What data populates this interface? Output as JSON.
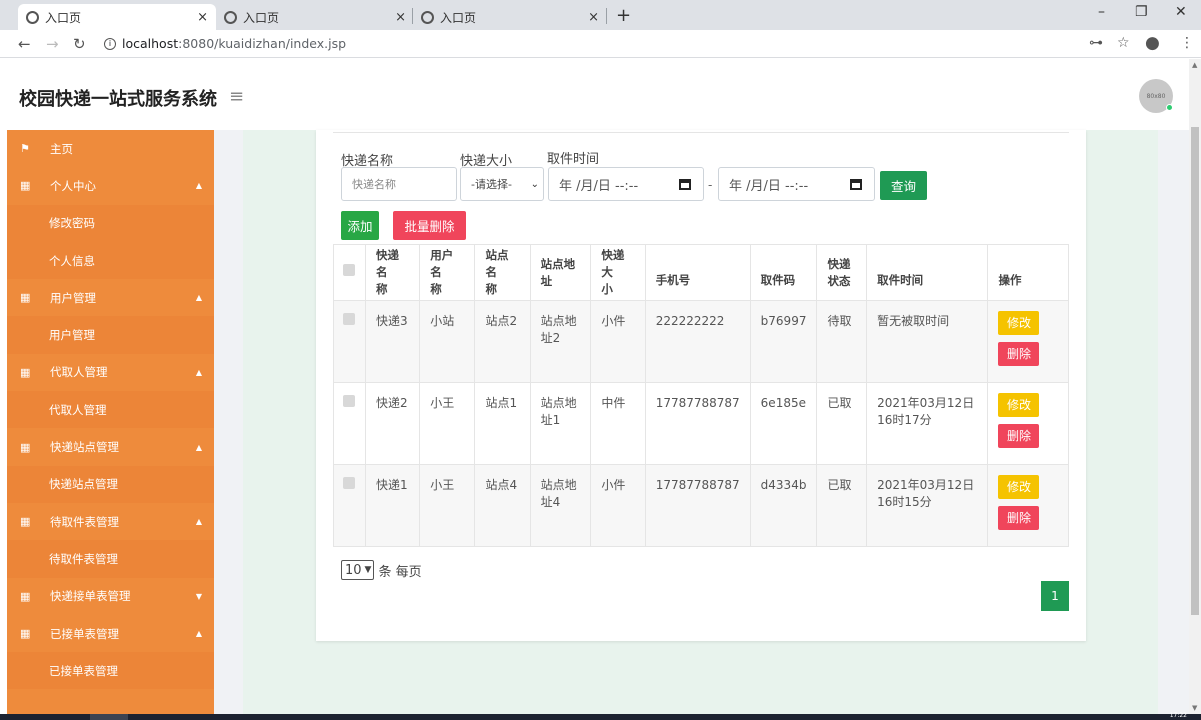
{
  "browser": {
    "tabs": [
      {
        "title": "入口页",
        "close": "×"
      },
      {
        "title": "入口页",
        "close": "×"
      },
      {
        "title": "入口页",
        "close": "×"
      }
    ],
    "new_tab": "+",
    "url_host": "localhost",
    "url_path": ":8080/kuaidizhan/index.jsp",
    "win_controls": [
      "–",
      "❐",
      "✕"
    ],
    "clock": "17:22"
  },
  "app": {
    "title": "校园快递一站式服务系统",
    "avatar_text": "80x80"
  },
  "sidebar": {
    "items": [
      {
        "label": "主页",
        "type": "group",
        "icon": "flag-icon",
        "caret": ""
      },
      {
        "label": "个人中心",
        "type": "group",
        "icon": "grid-icon",
        "caret": "▲"
      },
      {
        "label": "修改密码",
        "type": "sub"
      },
      {
        "label": "个人信息",
        "type": "sub"
      },
      {
        "label": "用户管理",
        "type": "group",
        "icon": "grid-icon",
        "caret": "▲"
      },
      {
        "label": "用户管理",
        "type": "sub"
      },
      {
        "label": "代取人管理",
        "type": "group",
        "icon": "grid-icon",
        "caret": "▲"
      },
      {
        "label": "代取人管理",
        "type": "sub"
      },
      {
        "label": "快递站点管理",
        "type": "group",
        "icon": "grid-icon",
        "caret": "▲"
      },
      {
        "label": "快递站点管理",
        "type": "sub"
      },
      {
        "label": "待取件表管理",
        "type": "group",
        "icon": "grid-icon",
        "caret": "▲"
      },
      {
        "label": "待取件表管理",
        "type": "sub"
      },
      {
        "label": "快递接单表管理",
        "type": "group",
        "icon": "grid-icon",
        "caret": "▼"
      },
      {
        "label": "已接单表管理",
        "type": "group",
        "icon": "grid-icon",
        "caret": "▲"
      },
      {
        "label": "已接单表管理",
        "type": "sub"
      }
    ]
  },
  "filters": {
    "name_label": "快递名称",
    "name_placeholder": "快递名称",
    "size_label": "快递大小",
    "size_value": "-请选择-",
    "time_label": "取件时间",
    "date_placeholder": "年 /月/日 --:--",
    "date_sep": "-",
    "query_label": "查询",
    "add_label": "添加",
    "batch_delete_label": "批量删除"
  },
  "table": {
    "headers": [
      "快递名称",
      "用户名称",
      "站点名称",
      "站点地址",
      "快递大小",
      "手机号",
      "取件码",
      "快递状态",
      "取件时间",
      "操作"
    ],
    "header_lines": [
      [
        "快递名",
        "称"
      ],
      [
        "用户名",
        "称"
      ],
      [
        "站点名",
        "称"
      ],
      [
        "站点地",
        "址"
      ],
      [
        "快递大",
        "小"
      ],
      [
        "手机号"
      ],
      [
        "取件码"
      ],
      [
        "快递",
        "状态"
      ],
      [
        "取件时间"
      ],
      [
        "操作"
      ]
    ],
    "rows": [
      {
        "name": "快递3",
        "user": "小站",
        "station": "站点2",
        "address": [
          "站点地",
          "址2"
        ],
        "size": "小件",
        "phone": "222222222",
        "code": "b76997",
        "status": "待取",
        "time": [
          "暂无被取时间"
        ]
      },
      {
        "name": "快递2",
        "user": "小王",
        "station": "站点1",
        "address": [
          "站点地",
          "址1"
        ],
        "size": "中件",
        "phone": "17787788787",
        "code": "6e185e",
        "status": "已取",
        "time": [
          "2021年03月12日",
          "16时17分"
        ]
      },
      {
        "name": "快递1",
        "user": "小王",
        "station": "站点4",
        "address": [
          "站点地",
          "址4"
        ],
        "size": "小件",
        "phone": "17787788787",
        "code": "d4334b",
        "status": "已取",
        "time": [
          "2021年03月12日",
          "16时15分"
        ]
      }
    ],
    "edit_label": "修改",
    "delete_label": "删除"
  },
  "pagination": {
    "page_size": "10",
    "page_size_suffix": "条 每页",
    "current_page": "1"
  },
  "colors": {
    "sidebar": "#ee8b3c",
    "primary_green": "#1f9a54",
    "danger": "#f0455b",
    "warning": "#f5c300"
  }
}
